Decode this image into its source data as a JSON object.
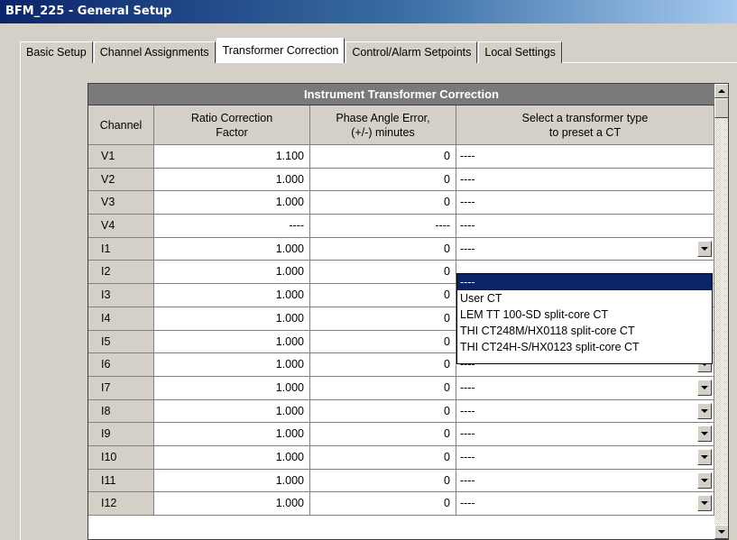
{
  "window": {
    "title": "BFM_225 - General Setup"
  },
  "tabs": [
    {
      "label": "Basic Setup"
    },
    {
      "label": "Channel Assignments"
    },
    {
      "label": "Transformer Correction"
    },
    {
      "label": "Control/Alarm Setpoints"
    },
    {
      "label": "Local Settings"
    }
  ],
  "active_tab": "Transformer Correction",
  "grid": {
    "title": "Instrument Transformer Correction",
    "headers": [
      "Channel",
      "Ratio Correction\nFactor",
      "Phase Angle Error,\n(+/-) minutes",
      "Select a transformer type\nto preset a CT"
    ],
    "rows": [
      {
        "channel": "V1",
        "ratio": "1.100",
        "phase": "0",
        "type": "----",
        "dropdown": false
      },
      {
        "channel": "V2",
        "ratio": "1.000",
        "phase": "0",
        "type": "----",
        "dropdown": false
      },
      {
        "channel": "V3",
        "ratio": "1.000",
        "phase": "0",
        "type": "----",
        "dropdown": false
      },
      {
        "channel": "V4",
        "ratio": "----",
        "phase": "----",
        "type": "----",
        "dropdown": false
      },
      {
        "channel": "I1",
        "ratio": "1.000",
        "phase": "0",
        "type": "----",
        "dropdown": true
      },
      {
        "channel": "I2",
        "ratio": "1.000",
        "phase": "0",
        "type": "",
        "dropdown": false
      },
      {
        "channel": "I3",
        "ratio": "1.000",
        "phase": "0",
        "type": "",
        "dropdown": false
      },
      {
        "channel": "I4",
        "ratio": "1.000",
        "phase": "0",
        "type": "",
        "dropdown": false
      },
      {
        "channel": "I5",
        "ratio": "1.000",
        "phase": "0",
        "type": "",
        "dropdown": false
      },
      {
        "channel": "I6",
        "ratio": "1.000",
        "phase": "0",
        "type": "----",
        "dropdown": true
      },
      {
        "channel": "I7",
        "ratio": "1.000",
        "phase": "0",
        "type": "----",
        "dropdown": true
      },
      {
        "channel": "I8",
        "ratio": "1.000",
        "phase": "0",
        "type": "----",
        "dropdown": true
      },
      {
        "channel": "I9",
        "ratio": "1.000",
        "phase": "0",
        "type": "----",
        "dropdown": true
      },
      {
        "channel": "I10",
        "ratio": "1.000",
        "phase": "0",
        "type": "----",
        "dropdown": true
      },
      {
        "channel": "I11",
        "ratio": "1.000",
        "phase": "0",
        "type": "----",
        "dropdown": true
      },
      {
        "channel": "I12",
        "ratio": "1.000",
        "phase": "0",
        "type": "----",
        "dropdown": true
      }
    ]
  },
  "open_dropdown": {
    "options": [
      "----",
      "User CT",
      "LEM TT 100-SD split-core CT",
      "THI CT248M/HX0118 split-core CT",
      "THI CT24H-S/HX0123 split-core CT"
    ],
    "selected_index": 0
  },
  "colors": {
    "title_bar": "#0a246a",
    "grid_title": "#7a7a7a",
    "selection": "#0a246a",
    "face": "#d4d0c8"
  }
}
